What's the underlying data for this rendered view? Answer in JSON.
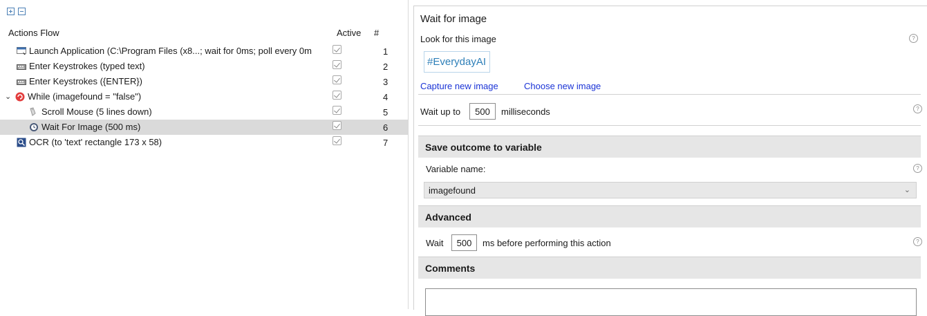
{
  "left_panel": {
    "toolbar": {
      "expand_icon": "expand-all-icon",
      "collapse_icon": "collapse-all-icon"
    },
    "columns": {
      "flow": "Actions Flow",
      "active": "Active",
      "number": "#"
    },
    "rows": [
      {
        "label": "Launch Application (C:\\Program Files (x8...; wait for 0ms; poll every 0m",
        "icon": "launch-app-icon",
        "active": true,
        "number": "1",
        "indent": 1,
        "selected": false
      },
      {
        "label": "Enter Keystrokes (typed text)",
        "icon": "keyboard-icon",
        "active": true,
        "number": "2",
        "indent": 1,
        "selected": false
      },
      {
        "label": "Enter Keystrokes ({ENTER})",
        "icon": "keyboard-icon",
        "active": true,
        "number": "3",
        "indent": 1,
        "selected": false
      },
      {
        "label": "While (imagefound = \"false\")",
        "icon": "while-loop-icon",
        "active": true,
        "number": "4",
        "indent": 0,
        "selected": false,
        "expanded": true
      },
      {
        "label": "Scroll Mouse (5 lines down)",
        "icon": "mouse-icon",
        "active": true,
        "number": "5",
        "indent": 2,
        "selected": false
      },
      {
        "label": "Wait For Image (500 ms)",
        "icon": "wait-image-icon",
        "active": true,
        "number": "6",
        "indent": 2,
        "selected": true
      },
      {
        "label": "OCR (to 'text' rectangle 173 x 58)",
        "icon": "ocr-icon",
        "active": true,
        "number": "7",
        "indent": 1,
        "selected": false
      }
    ]
  },
  "right_panel": {
    "title": "Wait for image",
    "look_label": "Look for this image",
    "image_text": "#EverydayAI",
    "capture_link": "Capture new image",
    "choose_link": "Choose new image",
    "wait_prefix": "Wait up to",
    "wait_value": "500",
    "wait_suffix": "milliseconds",
    "save_section": "Save outcome to variable",
    "variable_label": "Variable name:",
    "variable_value": "imagefound",
    "advanced_section": "Advanced",
    "adv_prefix": "Wait",
    "adv_value": "500",
    "adv_suffix": "ms before performing this action",
    "comments_section": "Comments",
    "help_glyph": "?"
  }
}
